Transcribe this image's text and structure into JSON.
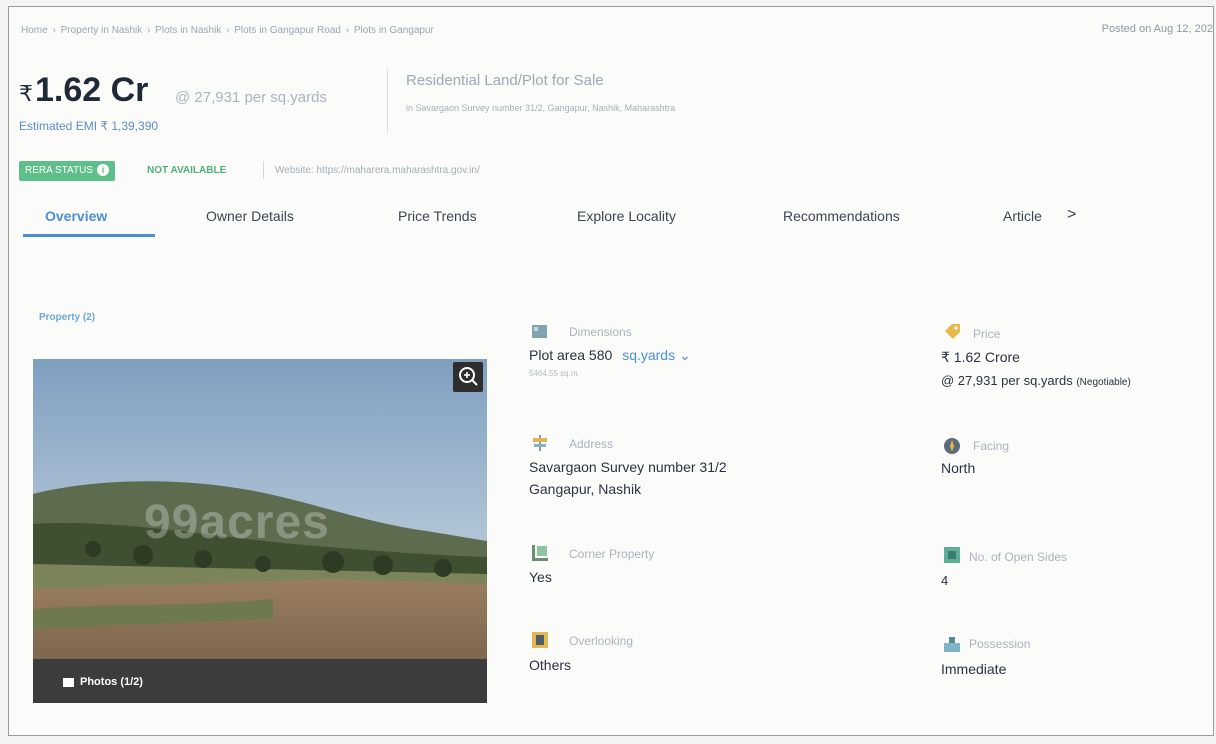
{
  "breadcrumb": [
    "Home",
    "Property in Nashik",
    "Plots in Nashik",
    "Plots in Gangapur Road",
    "Plots in Gangapur"
  ],
  "posted": "Posted on Aug 12, 202",
  "price": {
    "currency": "₹",
    "amount": "1.62 Cr",
    "per_unit": "@ 27,931 per sq.yards",
    "emi": "Estimated EMI ₹ 1,39,390"
  },
  "property": {
    "type": "Residential Land/Plot for Sale",
    "address": "in Savargaon Survey number 31/2, Gangapur, Nashik, Maharashtra"
  },
  "rera": {
    "badge": "RERA STATUS",
    "info_icon": "i",
    "status": "NOT AVAILABLE",
    "website": "Website: https://maharera.maharashtra.gov.in/"
  },
  "tabs": [
    "Overview",
    "Owner Details",
    "Price Trends",
    "Explore Locality",
    "Recommendations",
    "Article"
  ],
  "tab_arrow": ">",
  "section": {
    "title": "Property (2)",
    "photos_label": "Photos (1/2)",
    "watermark": "99acres"
  },
  "details": {
    "dimensions": {
      "label": "Dimensions",
      "value": "Plot area 580",
      "unit": "sq.yards",
      "sub": "5464.55 sq.m."
    },
    "price": {
      "label": "Price",
      "value": "₹ 1.62 Crore",
      "per": "@ 27,931 per sq.yards",
      "negotiable": "(Negotiable)"
    },
    "address": {
      "label": "Address",
      "line1": "Savargaon Survey number 31/2",
      "line2": "Gangapur, Nashik"
    },
    "facing": {
      "label": "Facing",
      "value": "North"
    },
    "corner": {
      "label": "Corner Property",
      "value": "Yes"
    },
    "open_sides": {
      "label": "No. of Open Sides",
      "value": "4"
    },
    "overlooking": {
      "label": "Overlooking",
      "value": "Others"
    },
    "possession": {
      "label": "Possession",
      "value": "Immediate"
    }
  },
  "colors": {
    "accent": "#4a8ed3",
    "rera_green": "#5fbf8a"
  }
}
